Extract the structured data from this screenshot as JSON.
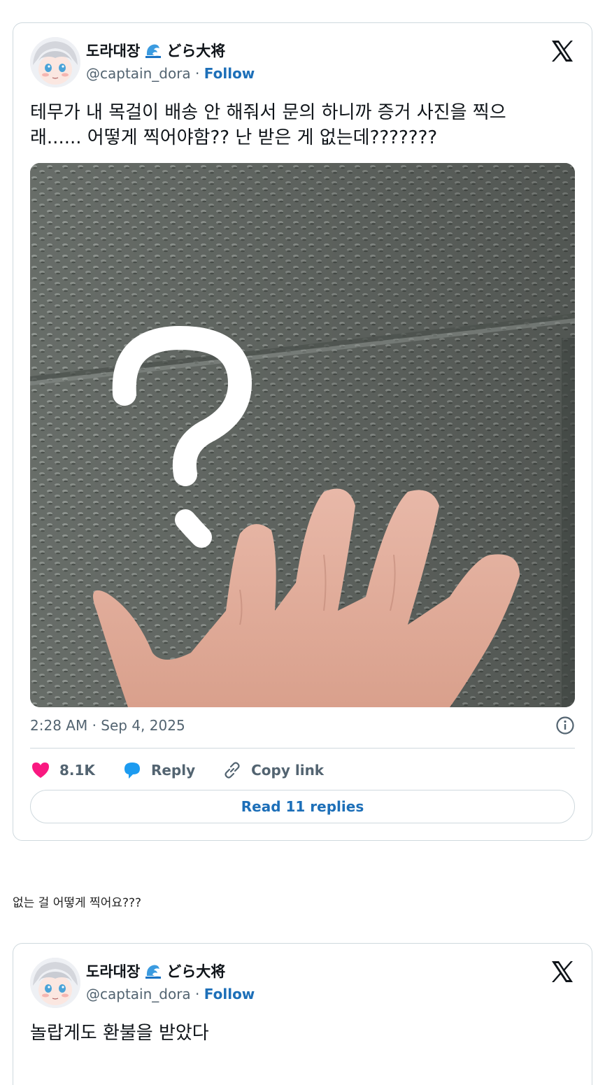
{
  "tweet1": {
    "display_name": "도라대장",
    "name_suffix": "どら大将",
    "handle": "@captain_dora",
    "separator": "·",
    "follow_label": "Follow",
    "text_line1": "테무가 내 목걸이 배송 안 해줘서 문의 하니까 증거 사진을 찍으",
    "text_line2": "래...... 어떻게 찍어야함?? 난 받은 게 없는데???????",
    "timestamp": "2:28 AM · Sep 4, 2025",
    "likes": "8.1K",
    "reply_label": "Reply",
    "copy_link_label": "Copy link",
    "read_replies_label": "Read 11 replies",
    "icons": [
      "avatar",
      "wave-badge-icon",
      "x-logo-icon",
      "info-icon",
      "heart-icon",
      "reply-bubble-icon",
      "link-icon"
    ],
    "colors": {
      "heart": "#f91880",
      "reply": "#1d9bf0",
      "link_text": "#1d6fb8"
    }
  },
  "caption": "없는 걸 어떻게 찍어요???",
  "tweet2": {
    "display_name": "도라대장",
    "name_suffix": "どら大将",
    "handle": "@captain_dora",
    "separator": "·",
    "follow_label": "Follow",
    "text": "놀랍게도 환불을 받았다"
  }
}
